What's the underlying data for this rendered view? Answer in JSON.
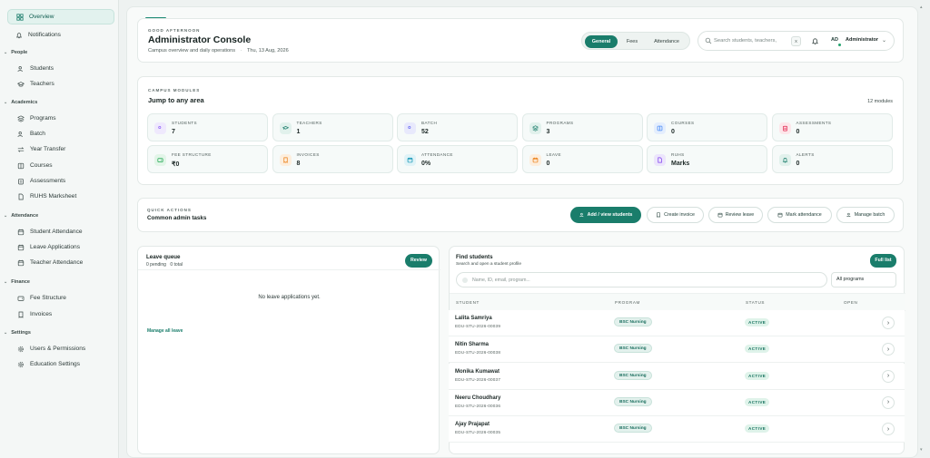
{
  "sidebar": {
    "overview": "Overview",
    "notifications": "Notifications",
    "sections": [
      {
        "title": "People",
        "items": [
          "Students",
          "Teachers"
        ]
      },
      {
        "title": "Academics",
        "items": [
          "Programs",
          "Batch",
          "Year Transfer",
          "Courses",
          "Assessments",
          "RUHS Marksheet"
        ]
      },
      {
        "title": "Attendance",
        "items": [
          "Student Attendance",
          "Leave Applications",
          "Teacher Attendance"
        ]
      },
      {
        "title": "Finance",
        "items": [
          "Fee Structure",
          "Invoices"
        ]
      },
      {
        "title": "Settings",
        "items": [
          "Users & Permissions",
          "Education Settings"
        ]
      }
    ]
  },
  "header": {
    "greeting": "GOOD AFTERNOON",
    "title": "Administrator Console",
    "subtitle": "Campus overview and daily operations",
    "date": "Thu, 13 Aug, 2026",
    "tabs": [
      "General",
      "Fees",
      "Attendance"
    ],
    "search_placeholder": "Search students, teachers,",
    "search_shortcut": "X",
    "avatar_initials": "AD",
    "user_role": "Administrator"
  },
  "modules": {
    "eyebrow": "CAMPUS MODULES",
    "title": "Jump to any area",
    "count": "12 modules",
    "items": [
      {
        "label": "STUDENTS",
        "value": "7",
        "icon": "users-icon",
        "color": "#8b5cf6",
        "bg": "#efe9fd"
      },
      {
        "label": "TEACHERS",
        "value": "1",
        "icon": "graduation-cap-icon",
        "color": "#1a7d6b",
        "bg": "#e1f1ec"
      },
      {
        "label": "BATCH",
        "value": "52",
        "icon": "users-icon",
        "color": "#6366f1",
        "bg": "#e8e9fc"
      },
      {
        "label": "PROGRAMS",
        "value": "3",
        "icon": "layers-icon",
        "color": "#1a7d6b",
        "bg": "#e1f1ec"
      },
      {
        "label": "COURSES",
        "value": "0",
        "icon": "book-icon",
        "color": "#3b82f6",
        "bg": "#e4eefd"
      },
      {
        "label": "ASSESSMENTS",
        "value": "0",
        "icon": "clipboard-icon",
        "color": "#e11d48",
        "bg": "#fde6ea"
      },
      {
        "label": "FEE STRUCTURE",
        "value": "₹0",
        "icon": "wallet-icon",
        "color": "#16a34a",
        "bg": "#e2f5e8"
      },
      {
        "label": "INVOICES",
        "value": "8",
        "icon": "receipt-icon",
        "color": "#ea7a0c",
        "bg": "#fdeedd"
      },
      {
        "label": "ATTENDANCE",
        "value": "0%",
        "icon": "calendar-icon",
        "color": "#0891b2",
        "bg": "#e0f3f7"
      },
      {
        "label": "LEAVE",
        "value": "0",
        "icon": "calendar-icon",
        "color": "#ea7a0c",
        "bg": "#fdeedd"
      },
      {
        "label": "RUHS",
        "value": "Marks",
        "icon": "document-icon",
        "color": "#7c3aed",
        "bg": "#ece5fc"
      },
      {
        "label": "ALERTS",
        "value": "0",
        "icon": "bell-icon",
        "color": "#1a7d6b",
        "bg": "#e1f1ec"
      }
    ]
  },
  "quick_actions": {
    "eyebrow": "QUICK ACTIONS",
    "title": "Common admin tasks",
    "buttons": [
      "Add / view students",
      "Create invoice",
      "Review leave",
      "Mark attendance",
      "Manage batch"
    ]
  },
  "leave_queue": {
    "title": "Leave queue",
    "pending": "0 pending",
    "total": "0 total",
    "review_label": "Review",
    "empty_text": "No leave applications yet.",
    "manage_link": "Manage all leave"
  },
  "find_students": {
    "title": "Find students",
    "subtitle": "Search and open a student profile",
    "full_list_label": "Full list",
    "search_placeholder": "Name, ID, email, program...",
    "program_filter": "All programs",
    "columns": [
      "STUDENT",
      "PROGRAM",
      "STATUS",
      "OPEN"
    ],
    "rows": [
      {
        "name": "Lalita Samriya",
        "id": "EDU-STU-2026-00039",
        "program": "BSC Nursing",
        "status": "ACTIVE"
      },
      {
        "name": "Nitin Sharma",
        "id": "EDU-STU-2026-00038",
        "program": "BSC Nursing",
        "status": "ACTIVE"
      },
      {
        "name": "Monika Kumawat",
        "id": "EDU-STU-2026-00037",
        "program": "BSC Nursing",
        "status": "ACTIVE"
      },
      {
        "name": "Neeru Choudhary",
        "id": "EDU-STU-2026-00036",
        "program": "BSC Nursing",
        "status": "ACTIVE"
      },
      {
        "name": "Ajay Prajapat",
        "id": "EDU-STU-2026-00035",
        "program": "BSC Nursing",
        "status": "ACTIVE"
      }
    ]
  },
  "colors": {
    "accent": "#1a7d6b"
  }
}
